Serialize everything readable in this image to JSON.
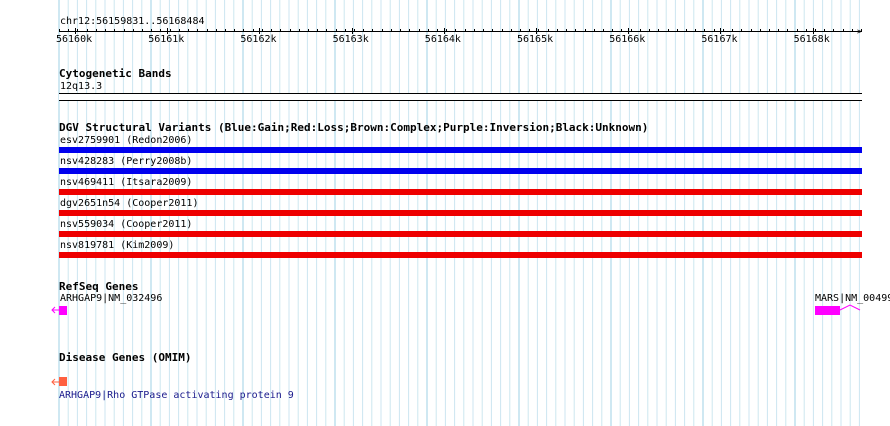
{
  "ruler": {
    "region": "chr12:56159831..56168484",
    "ticks": [
      "56160k",
      "56161k",
      "56162k",
      "56163k",
      "56164k",
      "56165k",
      "56166k",
      "56167k",
      "56168k"
    ]
  },
  "cytoband": {
    "title": "Cytogenetic Bands",
    "band": "12q13.3"
  },
  "dgv": {
    "title": "DGV Structural Variants (Blue:Gain;Red:Loss;Brown:Complex;Purple:Inversion;Black:Unknown)",
    "variants": [
      {
        "label": "esv2759901 (Redon2006)",
        "color": "#0000ee"
      },
      {
        "label": "nsv428283 (Perry2008b)",
        "color": "#0000ee"
      },
      {
        "label": "nsv469411 (Itsara2009)",
        "color": "#ee0000"
      },
      {
        "label": "dgv2651n54 (Cooper2011)",
        "color": "#ee0000"
      },
      {
        "label": "nsv559034 (Cooper2011)",
        "color": "#ee0000"
      },
      {
        "label": "nsv819781 (Kim2009)",
        "color": "#ee0000"
      }
    ]
  },
  "refseq": {
    "title": "RefSeq Genes",
    "gene_left": "ARHGAP9|NM_032496",
    "gene_right": "MARS|NM_00499",
    "color": "#ff00ff"
  },
  "disease": {
    "title": "Disease Genes (OMIM)",
    "gene": "ARHGAP9|Rho GTPase activating protein 9",
    "color": "#ff6040"
  }
}
